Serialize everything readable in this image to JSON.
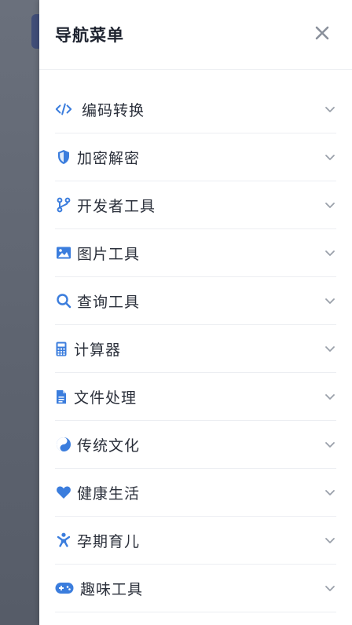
{
  "drawer": {
    "title": "导航菜单",
    "close_icon": "close-icon",
    "accent_color": "#3b7ddd"
  },
  "menu": {
    "items": [
      {
        "label": "编码转换",
        "icon": "code-icon"
      },
      {
        "label": "加密解密",
        "icon": "shield-icon"
      },
      {
        "label": "开发者工具",
        "icon": "git-branch-icon"
      },
      {
        "label": "图片工具",
        "icon": "image-icon"
      },
      {
        "label": "查询工具",
        "icon": "search-icon"
      },
      {
        "label": "计算器",
        "icon": "calculator-icon"
      },
      {
        "label": "文件处理",
        "icon": "file-icon"
      },
      {
        "label": "传统文化",
        "icon": "yin-yang-icon"
      },
      {
        "label": "健康生活",
        "icon": "heart-icon"
      },
      {
        "label": "孕期育儿",
        "icon": "baby-icon"
      },
      {
        "label": "趣味工具",
        "icon": "gamepad-icon"
      }
    ]
  }
}
